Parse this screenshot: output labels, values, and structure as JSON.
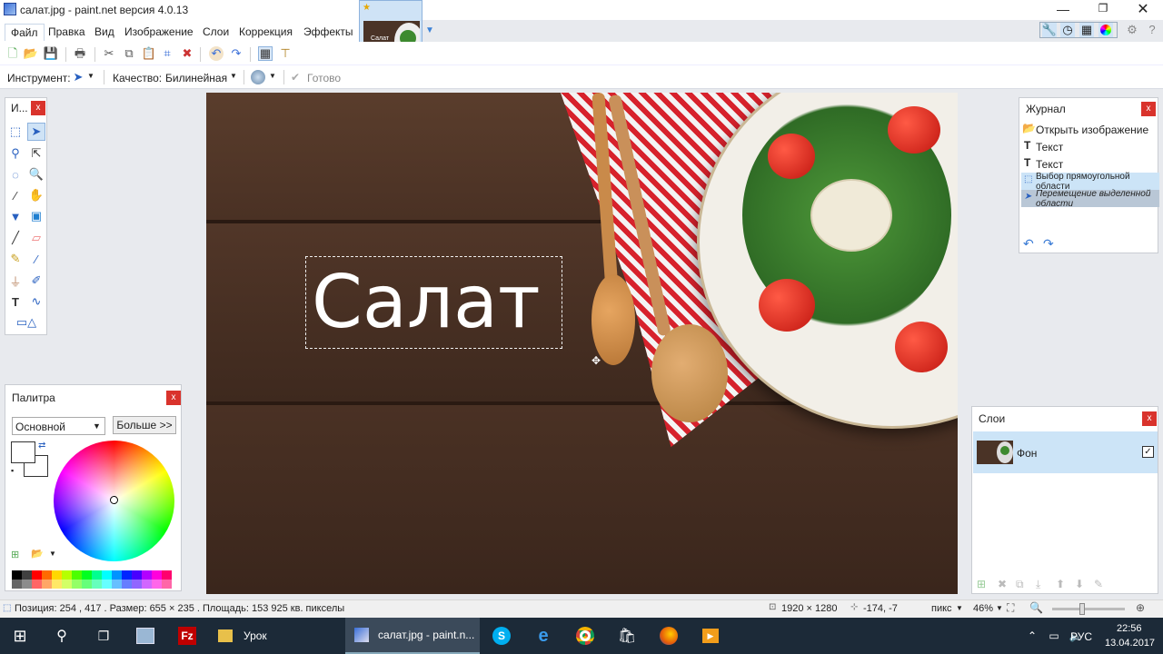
{
  "window": {
    "title": "салат.jpg - paint.net версия 4.0.13"
  },
  "menu": [
    "Файл",
    "Правка",
    "Вид",
    "Изображение",
    "Слои",
    "Коррекция",
    "Эффекты"
  ],
  "thumb_label": "Салат",
  "toolbar2": {
    "tool_label": "Инструмент:",
    "quality_label": "Качество:",
    "quality_value": "Билинейная",
    "done_label": "Готово"
  },
  "tools_panel": {
    "title": "И..."
  },
  "canvas": {
    "text": "Салат"
  },
  "history": {
    "title": "Журнал",
    "items": [
      "Открыть изображение",
      "Текст",
      "Текст",
      "Выбор прямоугольной области",
      "Перемещение выделенной области"
    ]
  },
  "palette": {
    "title": "Палитра",
    "mode": "Основной",
    "more_button": "Больше >>",
    "colors": [
      "#000000",
      "#404040",
      "#ff0000",
      "#ff6a00",
      "#ffd800",
      "#b6ff00",
      "#4cff00",
      "#00ff21",
      "#00ff90",
      "#00ffff",
      "#0094ff",
      "#0026ff",
      "#4800ff",
      "#b200ff",
      "#ff00dc",
      "#ff006e"
    ]
  },
  "layers": {
    "title": "Слои",
    "items": [
      {
        "name": "Фон",
        "visible": true
      }
    ]
  },
  "status": {
    "position": "Позиция: 254 , 417 . Размер: 655 × 235 . Площадь: 153 925 кв. пикселы",
    "image_size": "1920 × 1280",
    "cursor": "-174, -7",
    "unit": "пикс",
    "zoom": "46%"
  },
  "taskbar": {
    "folder_label": "Урок",
    "active_app": "салат.jpg - paint.n...",
    "lang": "РУС",
    "time": "22:56",
    "date": "13.04.2017"
  },
  "colors": {
    "accent": "#cce4f7",
    "close": "#d9332c",
    "taskbar": "#1c2a38"
  }
}
